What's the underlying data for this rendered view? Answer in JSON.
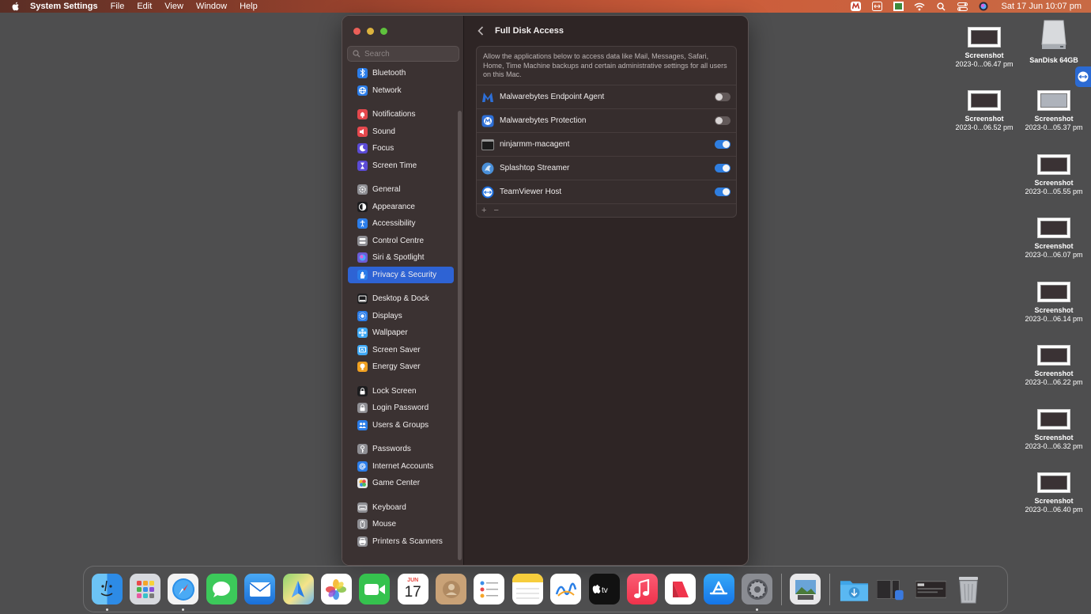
{
  "menubar": {
    "app_name": "System Settings",
    "menus": [
      "File",
      "Edit",
      "View",
      "Window",
      "Help"
    ],
    "clock": "Sat 17 Jun  10:07 pm"
  },
  "window": {
    "search_placeholder": "Search",
    "sidebar": {
      "groups": [
        [
          {
            "label": "Bluetooth",
            "icon": "bluetooth-icon",
            "color": "#2b7de9"
          },
          {
            "label": "Network",
            "icon": "globe-icon",
            "color": "#2b7de9"
          }
        ],
        [
          {
            "label": "Notifications",
            "icon": "bell-icon",
            "color": "#e5484d"
          },
          {
            "label": "Sound",
            "icon": "speaker-icon",
            "color": "#e5484d"
          },
          {
            "label": "Focus",
            "icon": "moon-icon",
            "color": "#5b4bd6"
          },
          {
            "label": "Screen Time",
            "icon": "hourglass-icon",
            "color": "#5b4bd6"
          }
        ],
        [
          {
            "label": "General",
            "icon": "gear-icon",
            "color": "#8e8e93"
          },
          {
            "label": "Appearance",
            "icon": "appearance-icon",
            "color": "#1c1c1e"
          },
          {
            "label": "Accessibility",
            "icon": "accessibility-icon",
            "color": "#2b7de9"
          },
          {
            "label": "Control Centre",
            "icon": "control-centre-icon",
            "color": "#8e8e93"
          },
          {
            "label": "Siri & Spotlight",
            "icon": "siri-icon",
            "color": "#6b5bd6"
          },
          {
            "label": "Privacy & Security",
            "icon": "hand-icon",
            "color": "#2b7de9",
            "active": true
          }
        ],
        [
          {
            "label": "Desktop & Dock",
            "icon": "dock-icon",
            "color": "#1c1c1e"
          },
          {
            "label": "Displays",
            "icon": "sun-icon",
            "color": "#2b7de9"
          },
          {
            "label": "Wallpaper",
            "icon": "flower-icon",
            "color": "#3fa9f5"
          },
          {
            "label": "Screen Saver",
            "icon": "screensaver-icon",
            "color": "#3fa9f5"
          },
          {
            "label": "Energy Saver",
            "icon": "bulb-icon",
            "color": "#f0a020"
          }
        ],
        [
          {
            "label": "Lock Screen",
            "icon": "lock-icon",
            "color": "#1c1c1e"
          },
          {
            "label": "Login Password",
            "icon": "lock-icon",
            "color": "#8e8e93"
          },
          {
            "label": "Users & Groups",
            "icon": "users-icon",
            "color": "#2b7de9"
          }
        ],
        [
          {
            "label": "Passwords",
            "icon": "key-icon",
            "color": "#8e8e93"
          },
          {
            "label": "Internet Accounts",
            "icon": "at-icon",
            "color": "#2b7de9"
          },
          {
            "label": "Game Center",
            "icon": "gamecenter-icon",
            "color": "#e8e8e8"
          }
        ],
        [
          {
            "label": "Keyboard",
            "icon": "keyboard-icon",
            "color": "#8e8e93"
          },
          {
            "label": "Mouse",
            "icon": "mouse-icon",
            "color": "#8e8e93"
          },
          {
            "label": "Printers & Scanners",
            "icon": "printer-icon",
            "color": "#8e8e93"
          }
        ]
      ]
    },
    "main": {
      "title": "Full Disk Access",
      "description": "Allow the applications below to access data like Mail, Messages, Safari, Home, Time Machine backups and certain administrative settings for all users on this Mac.",
      "apps": [
        {
          "label": "Malwarebytes Endpoint Agent",
          "icon": "malwarebytes-icon",
          "enabled": false
        },
        {
          "label": "Malwarebytes Protection",
          "icon": "malwarebytes-protection-icon",
          "enabled": false
        },
        {
          "label": "ninjarmm-macagent",
          "icon": "terminal-icon",
          "enabled": true
        },
        {
          "label": "Splashtop Streamer",
          "icon": "splashtop-icon",
          "enabled": true
        },
        {
          "label": "TeamViewer Host",
          "icon": "teamviewer-icon",
          "enabled": true
        }
      ],
      "add_label": "+",
      "remove_label": "−"
    }
  },
  "desktop": {
    "drive": {
      "label": "SanDisk 64GB"
    },
    "screenshots": [
      {
        "label": "Screenshot",
        "sub": "2023-0...06.47 pm"
      },
      {
        "label": "Screenshot",
        "sub": "2023-0...06.52 pm"
      },
      {
        "label": "Screenshot",
        "sub": "2023-0...05.37 pm"
      },
      {
        "label": "Screenshot",
        "sub": "2023-0...05.55 pm"
      },
      {
        "label": "Screenshot",
        "sub": "2023-0...06.07 pm"
      },
      {
        "label": "Screenshot",
        "sub": "2023-0...06.14 pm"
      },
      {
        "label": "Screenshot",
        "sub": "2023-0...06.22 pm"
      },
      {
        "label": "Screenshot",
        "sub": "2023-0...06.32 pm"
      },
      {
        "label": "Screenshot",
        "sub": "2023-0...06.40 pm"
      }
    ]
  },
  "dock": {
    "calendar_month": "JUN",
    "calendar_day": "17",
    "apps": [
      "finder-icon",
      "launchpad-icon",
      "safari-icon",
      "messages-icon",
      "mail-icon",
      "maps-icon",
      "photos-icon",
      "facetime-icon",
      "calendar-icon",
      "contacts-icon",
      "reminders-icon",
      "notes-icon",
      "freeform-icon",
      "tv-icon",
      "music-icon",
      "news-icon",
      "app-store-icon",
      "system-settings-icon"
    ]
  }
}
